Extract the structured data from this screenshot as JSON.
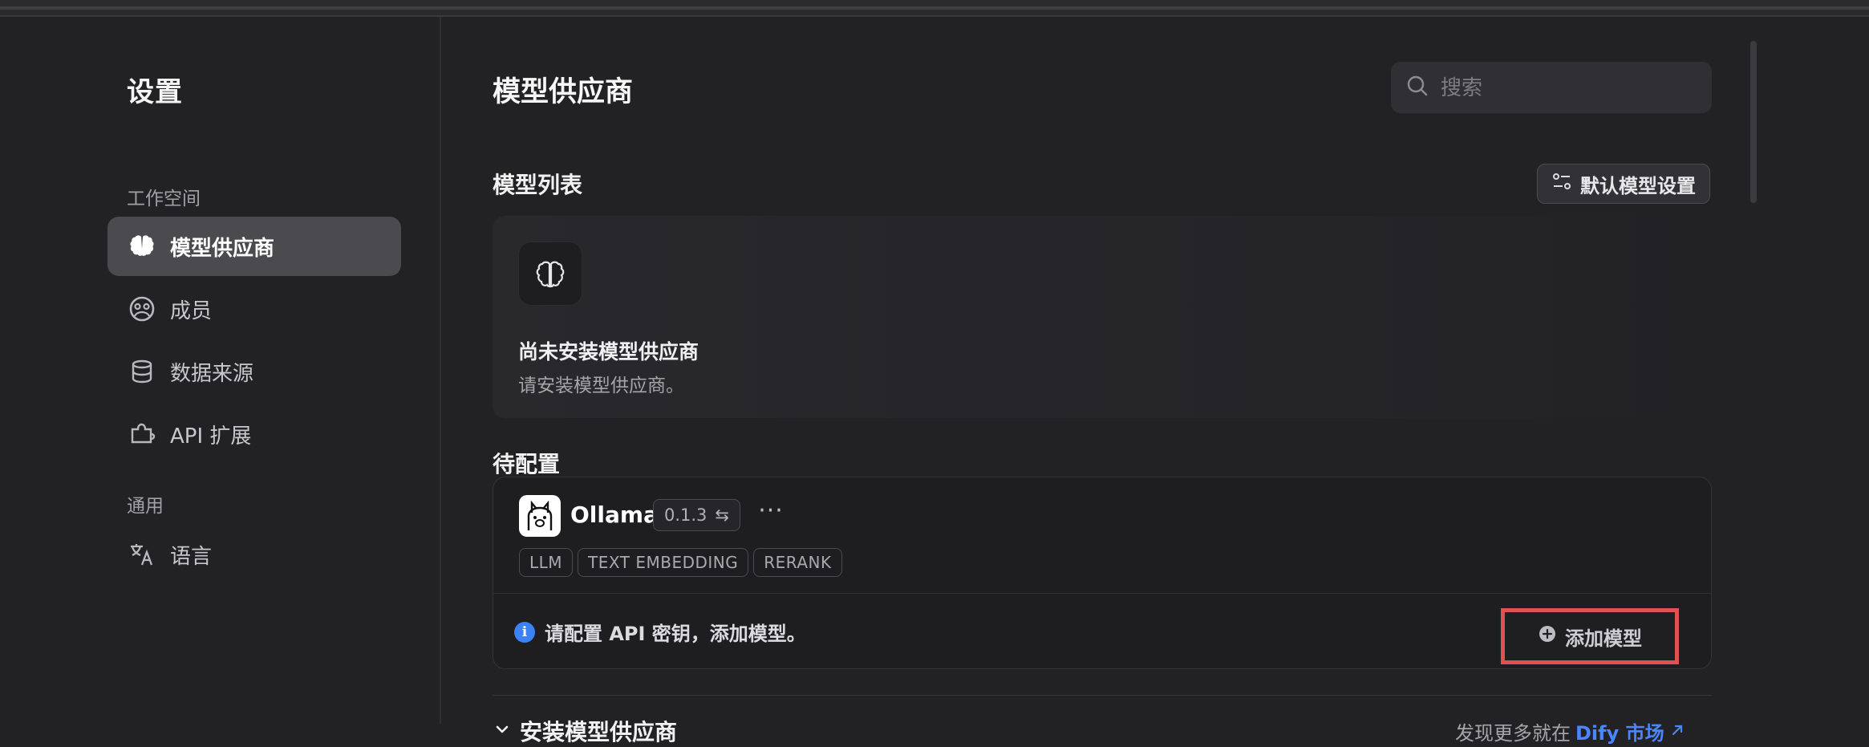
{
  "sidebar": {
    "title": "设置",
    "sections": [
      {
        "label": "工作空间",
        "items": [
          {
            "label": "模型供应商",
            "icon": "brain-icon",
            "active": true
          },
          {
            "label": "成员",
            "icon": "members-icon",
            "active": false
          },
          {
            "label": "数据来源",
            "icon": "database-icon",
            "active": false
          },
          {
            "label": "API 扩展",
            "icon": "puzzle-icon",
            "active": false
          }
        ]
      },
      {
        "label": "通用",
        "items": [
          {
            "label": "语言",
            "icon": "translate-icon",
            "active": false
          }
        ]
      }
    ]
  },
  "main": {
    "title": "模型供应商",
    "search": {
      "placeholder": "搜索",
      "value": ""
    },
    "model_list": {
      "title": "模型列表",
      "default_button": "默认模型设置",
      "empty_title": "尚未安装模型供应商",
      "empty_desc": "请安装模型供应商。"
    },
    "pending": {
      "title": "待配置",
      "provider": {
        "name": "Ollama",
        "version": "0.1.3",
        "more": "···",
        "tags": [
          "LLM",
          "TEXT EMBEDDING",
          "RERANK"
        ],
        "notice": "请配置 API 密钥，添加模型。",
        "add_model": "添加模型"
      }
    },
    "install": {
      "title": "安装模型供应商",
      "discover_text": "发现更多就在",
      "market_label": "Dify 市场"
    }
  },
  "colors": {
    "background": "#222225",
    "accent_blue": "#4a86ff",
    "highlight_red": "#e05252"
  }
}
